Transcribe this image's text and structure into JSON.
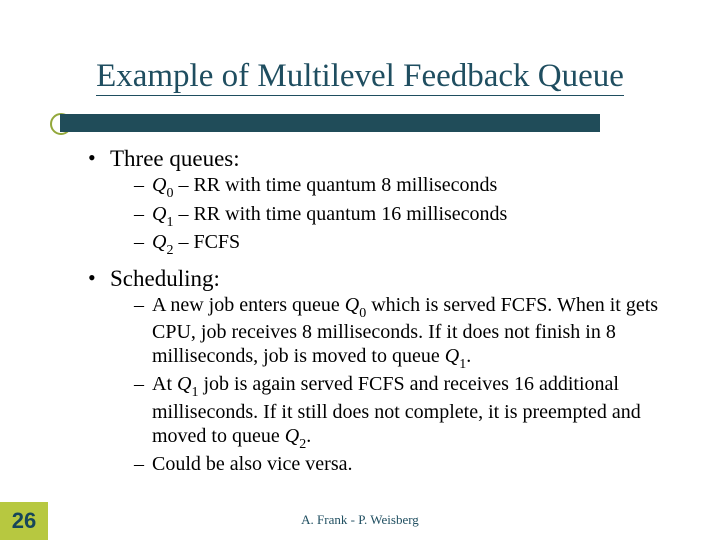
{
  "title": "Example of Multilevel Feedback Queue",
  "bullets": {
    "b0": {
      "label": "Three queues:",
      "sub": {
        "s0": {
          "pre": "Q",
          "sub": "0",
          "rest": " – RR with time quantum 8 milliseconds"
        },
        "s1": {
          "pre": "Q",
          "sub": "1",
          "rest": " – RR with time quantum 16 milliseconds"
        },
        "s2": {
          "pre": "Q",
          "sub": "2",
          "rest": " – FCFS"
        }
      }
    },
    "b1": {
      "label": "Scheduling:",
      "sub": {
        "s0": {
          "t0": "A new job enters queue ",
          "q0p": "Q",
          "q0s": "0",
          "t1": " which is served FCFS. When it gets CPU, job receives 8 milliseconds.  If it does not finish in 8 milliseconds, job is moved to queue ",
          "q1p": "Q",
          "q1s": "1",
          "t2": "."
        },
        "s1": {
          "t0": "At ",
          "q0p": "Q",
          "q0s": "1",
          "t1": " job is again served FCFS and receives 16 additional milliseconds.  If it still does not complete, it is preempted and moved to queue ",
          "q1p": "Q",
          "q1s": "2",
          "t2": "."
        },
        "s2": {
          "t0": "Could be also vice versa."
        }
      }
    }
  },
  "slide_number": "26",
  "footer": "A. Frank - P. Weisberg"
}
